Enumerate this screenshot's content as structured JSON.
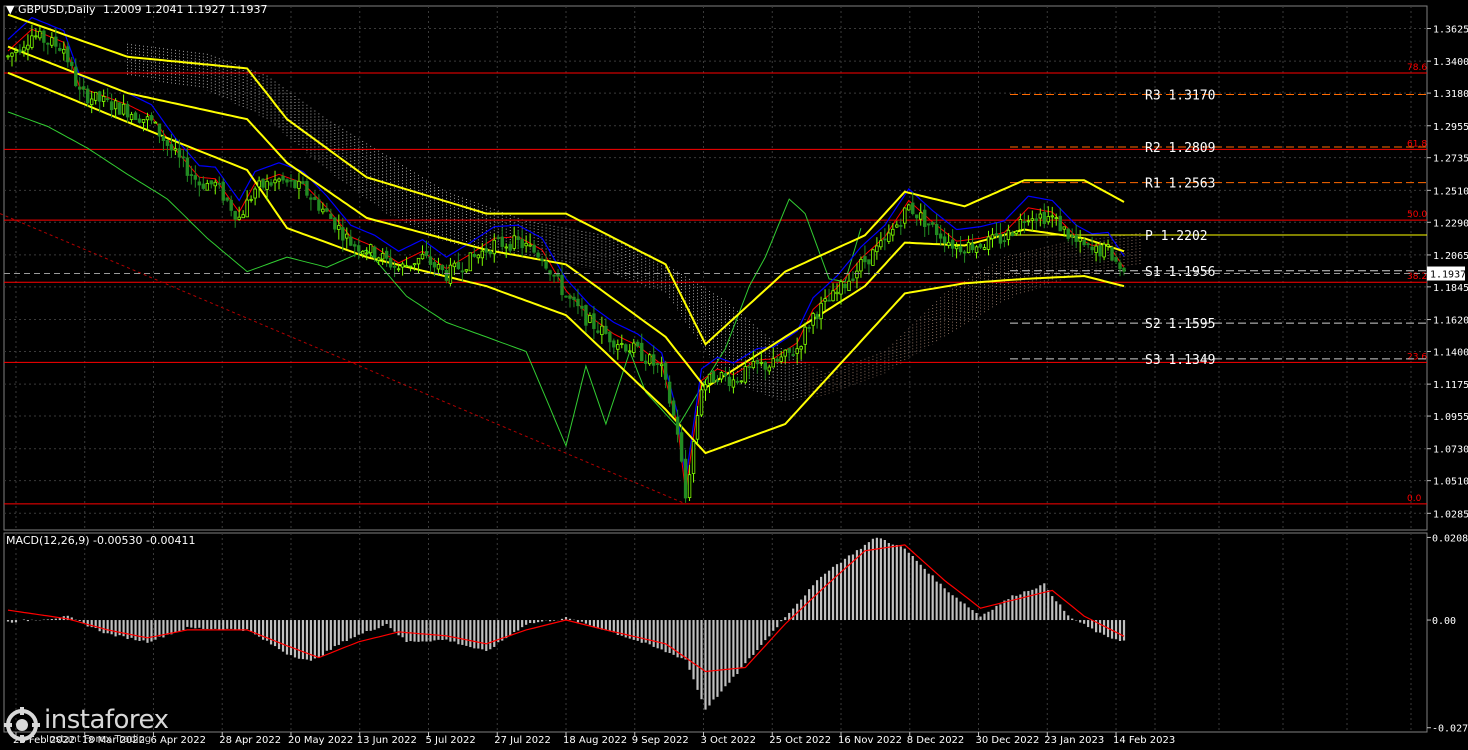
{
  "header": {
    "symbol": "GBPUSD,Daily",
    "ohlc": "1.2009 1.2041 1.1927 1.1937",
    "menu_icon": "triangle-down-icon"
  },
  "macd_header": "MACD(12,26,9) -0.00530 -0.00411",
  "logo": {
    "word": "instaforex",
    "tagline": "Instant Forex Trading",
    "icon": "instaforex-logo-icon"
  },
  "colors": {
    "background": "#000000",
    "grid": "#3a3a3a",
    "bull": "#7fff00",
    "bear": "#228b22",
    "bollinger": "#ffff00",
    "tenkan": "#ff0000",
    "kijun": "#0000ff",
    "chikou": "#32cd32",
    "fib": "#ff0000",
    "pivot": "#ffff00",
    "support_resistance": "#ff6a00",
    "histogram": "#c0c0c0",
    "signal": "#ff0000"
  },
  "chart_data": {
    "type": "candlestick",
    "symbol": "GBPUSD",
    "timeframe": "Daily",
    "ylim": [
      1.017,
      1.378
    ],
    "y_ticks": [
      "1.3625",
      "1.3400",
      "1.3180",
      "1.2955",
      "1.2735",
      "1.2510",
      "1.2290",
      "1.2065",
      "1.1845",
      "1.1620",
      "1.1400",
      "1.1175",
      "1.0955",
      "1.0730",
      "1.0510",
      "1.0285"
    ],
    "x_ticks": [
      "28 Feb 2022",
      "18 Mar 2022",
      "6 Apr 2022",
      "28 Apr 2022",
      "20 May 2022",
      "13 Jun 2022",
      "5 Jul 2022",
      "27 Jul 2022",
      "18 Aug 2022",
      "9 Sep 2022",
      "3 Oct 2022",
      "25 Oct 2022",
      "16 Nov 2022",
      "8 Dec 2022",
      "30 Dec 2022",
      "23 Jan 2023",
      "14 Feb 2023"
    ],
    "price_path": [
      [
        0,
        1.343
      ],
      [
        6,
        1.358
      ],
      [
        14,
        1.349
      ],
      [
        18,
        1.318
      ],
      [
        24,
        1.312
      ],
      [
        30,
        1.306
      ],
      [
        36,
        1.298
      ],
      [
        42,
        1.275
      ],
      [
        48,
        1.256
      ],
      [
        52,
        1.255
      ],
      [
        58,
        1.232
      ],
      [
        62,
        1.252
      ],
      [
        68,
        1.258
      ],
      [
        74,
        1.252
      ],
      [
        80,
        1.235
      ],
      [
        86,
        1.215
      ],
      [
        92,
        1.208
      ],
      [
        98,
        1.197
      ],
      [
        104,
        1.205
      ],
      [
        110,
        1.193
      ],
      [
        116,
        1.203
      ],
      [
        122,
        1.214
      ],
      [
        128,
        1.215
      ],
      [
        134,
        1.206
      ],
      [
        140,
        1.178
      ],
      [
        146,
        1.16
      ],
      [
        152,
        1.148
      ],
      [
        158,
        1.14
      ],
      [
        164,
        1.127
      ],
      [
        168,
        1.085
      ],
      [
        170,
        1.039
      ],
      [
        174,
        1.116
      ],
      [
        178,
        1.124
      ],
      [
        182,
        1.12
      ],
      [
        188,
        1.13
      ],
      [
        192,
        1.131
      ],
      [
        198,
        1.142
      ],
      [
        202,
        1.165
      ],
      [
        208,
        1.18
      ],
      [
        214,
        1.2
      ],
      [
        220,
        1.215
      ],
      [
        226,
        1.24
      ],
      [
        232,
        1.225
      ],
      [
        238,
        1.212
      ],
      [
        244,
        1.214
      ],
      [
        250,
        1.218
      ],
      [
        256,
        1.235
      ],
      [
        262,
        1.232
      ],
      [
        268,
        1.215
      ],
      [
        272,
        1.209
      ],
      [
        276,
        1.21
      ],
      [
        280,
        1.1937
      ]
    ],
    "bollinger_upper": [
      [
        0,
        1.372
      ],
      [
        30,
        1.343
      ],
      [
        60,
        1.335
      ],
      [
        70,
        1.3
      ],
      [
        90,
        1.26
      ],
      [
        120,
        1.235
      ],
      [
        140,
        1.235
      ],
      [
        165,
        1.2
      ],
      [
        175,
        1.145
      ],
      [
        195,
        1.195
      ],
      [
        215,
        1.22
      ],
      [
        225,
        1.25
      ],
      [
        240,
        1.24
      ],
      [
        255,
        1.258
      ],
      [
        270,
        1.258
      ],
      [
        280,
        1.243
      ]
    ],
    "bollinger_middle": [
      [
        0,
        1.35
      ],
      [
        30,
        1.318
      ],
      [
        60,
        1.3
      ],
      [
        70,
        1.27
      ],
      [
        90,
        1.232
      ],
      [
        120,
        1.21
      ],
      [
        140,
        1.2
      ],
      [
        165,
        1.15
      ],
      [
        175,
        1.115
      ],
      [
        195,
        1.15
      ],
      [
        215,
        1.185
      ],
      [
        225,
        1.215
      ],
      [
        240,
        1.213
      ],
      [
        255,
        1.224
      ],
      [
        270,
        1.218
      ],
      [
        280,
        1.209
      ]
    ],
    "bollinger_lower": [
      [
        0,
        1.332
      ],
      [
        30,
        1.298
      ],
      [
        60,
        1.265
      ],
      [
        70,
        1.225
      ],
      [
        90,
        1.205
      ],
      [
        120,
        1.185
      ],
      [
        140,
        1.165
      ],
      [
        165,
        1.1
      ],
      [
        175,
        1.07
      ],
      [
        195,
        1.09
      ],
      [
        215,
        1.15
      ],
      [
        225,
        1.18
      ],
      [
        240,
        1.187
      ],
      [
        255,
        1.19
      ],
      [
        270,
        1.192
      ],
      [
        280,
        1.185
      ]
    ],
    "chikou_path": [
      [
        0,
        1.305
      ],
      [
        10,
        1.295
      ],
      [
        20,
        1.28
      ],
      [
        30,
        1.262
      ],
      [
        40,
        1.245
      ],
      [
        50,
        1.218
      ],
      [
        60,
        1.195
      ],
      [
        70,
        1.205
      ],
      [
        80,
        1.198
      ],
      [
        90,
        1.21
      ],
      [
        100,
        1.178
      ],
      [
        110,
        1.16
      ],
      [
        120,
        1.15
      ],
      [
        130,
        1.14
      ],
      [
        140,
        1.075
      ],
      [
        145,
        1.13
      ],
      [
        150,
        1.09
      ],
      [
        156,
        1.14
      ],
      [
        160,
        1.112
      ],
      [
        168,
        1.088
      ],
      [
        175,
        1.12
      ],
      [
        180,
        1.142
      ],
      [
        186,
        1.185
      ],
      [
        190,
        1.205
      ],
      [
        196,
        1.245
      ],
      [
        200,
        1.235
      ],
      [
        206,
        1.19
      ],
      [
        210,
        1.188
      ],
      [
        214,
        1.225
      ]
    ],
    "fibonacci": [
      {
        "label": "78.6",
        "price": 1.3318
      },
      {
        "label": "61.8",
        "price": 1.2792
      },
      {
        "label": "50.0",
        "price": 1.2305
      },
      {
        "label": "38.2",
        "price": 1.1877
      },
      {
        "label": "23.6",
        "price": 1.1325
      },
      {
        "label": "0.0",
        "price": 1.035
      }
    ],
    "pivots": [
      {
        "label": "R3",
        "value": "1.3170",
        "price": 1.317,
        "kind": "resistance"
      },
      {
        "label": "R2",
        "value": "1.2809",
        "price": 1.2809,
        "kind": "resistance"
      },
      {
        "label": "R1",
        "value": "1.2563",
        "price": 1.2563,
        "kind": "resistance"
      },
      {
        "label": "P",
        "value": "1.2202",
        "price": 1.2202,
        "kind": "pivot"
      },
      {
        "label": "S1",
        "value": "1.1956",
        "price": 1.1956,
        "kind": "support"
      },
      {
        "label": "S2",
        "value": "1.1595",
        "price": 1.1595,
        "kind": "support"
      },
      {
        "label": "S3",
        "value": "1.1349",
        "price": 1.1349,
        "kind": "support"
      }
    ],
    "current_price": "1.1937",
    "macd": {
      "ylim": [
        -0.0283,
        0.022
      ],
      "y_ticks": [
        "0.02088",
        "0.00",
        "-0.02722"
      ],
      "histogram_path": [
        [
          0,
          -0.0005
        ],
        [
          15,
          0.0008
        ],
        [
          25,
          -0.0035
        ],
        [
          35,
          -0.0055
        ],
        [
          45,
          -0.002
        ],
        [
          60,
          -0.0025
        ],
        [
          70,
          -0.0085
        ],
        [
          76,
          -0.0105
        ],
        [
          85,
          -0.005
        ],
        [
          95,
          -0.001
        ],
        [
          100,
          -0.0055
        ],
        [
          110,
          -0.005
        ],
        [
          120,
          -0.008
        ],
        [
          130,
          -0.001
        ],
        [
          140,
          0.0005
        ],
        [
          150,
          -0.0025
        ],
        [
          160,
          -0.006
        ],
        [
          170,
          -0.01
        ],
        [
          175,
          -0.0225
        ],
        [
          180,
          -0.017
        ],
        [
          188,
          -0.0075
        ],
        [
          196,
          0.002
        ],
        [
          205,
          0.012
        ],
        [
          218,
          0.021
        ],
        [
          225,
          0.018
        ],
        [
          235,
          0.008
        ],
        [
          244,
          0.001
        ],
        [
          252,
          0.006
        ],
        [
          260,
          0.009
        ],
        [
          266,
          0.001
        ],
        [
          275,
          -0.004
        ],
        [
          280,
          -0.0053
        ]
      ],
      "signal_path": [
        [
          0,
          0.0025
        ],
        [
          15,
          0.0003
        ],
        [
          25,
          -0.0025
        ],
        [
          35,
          -0.0045
        ],
        [
          45,
          -0.0025
        ],
        [
          60,
          -0.0025
        ],
        [
          70,
          -0.0065
        ],
        [
          78,
          -0.0095
        ],
        [
          88,
          -0.0055
        ],
        [
          98,
          -0.003
        ],
        [
          110,
          -0.004
        ],
        [
          120,
          -0.006
        ],
        [
          130,
          -0.0025
        ],
        [
          140,
          0.0
        ],
        [
          150,
          -0.0025
        ],
        [
          165,
          -0.006
        ],
        [
          175,
          -0.013
        ],
        [
          185,
          -0.012
        ],
        [
          195,
          -0.001
        ],
        [
          205,
          0.0085
        ],
        [
          215,
          0.0175
        ],
        [
          225,
          0.019
        ],
        [
          235,
          0.01
        ],
        [
          244,
          0.003
        ],
        [
          252,
          0.005
        ],
        [
          262,
          0.0075
        ],
        [
          270,
          0.001
        ],
        [
          280,
          -0.0041
        ]
      ]
    }
  }
}
